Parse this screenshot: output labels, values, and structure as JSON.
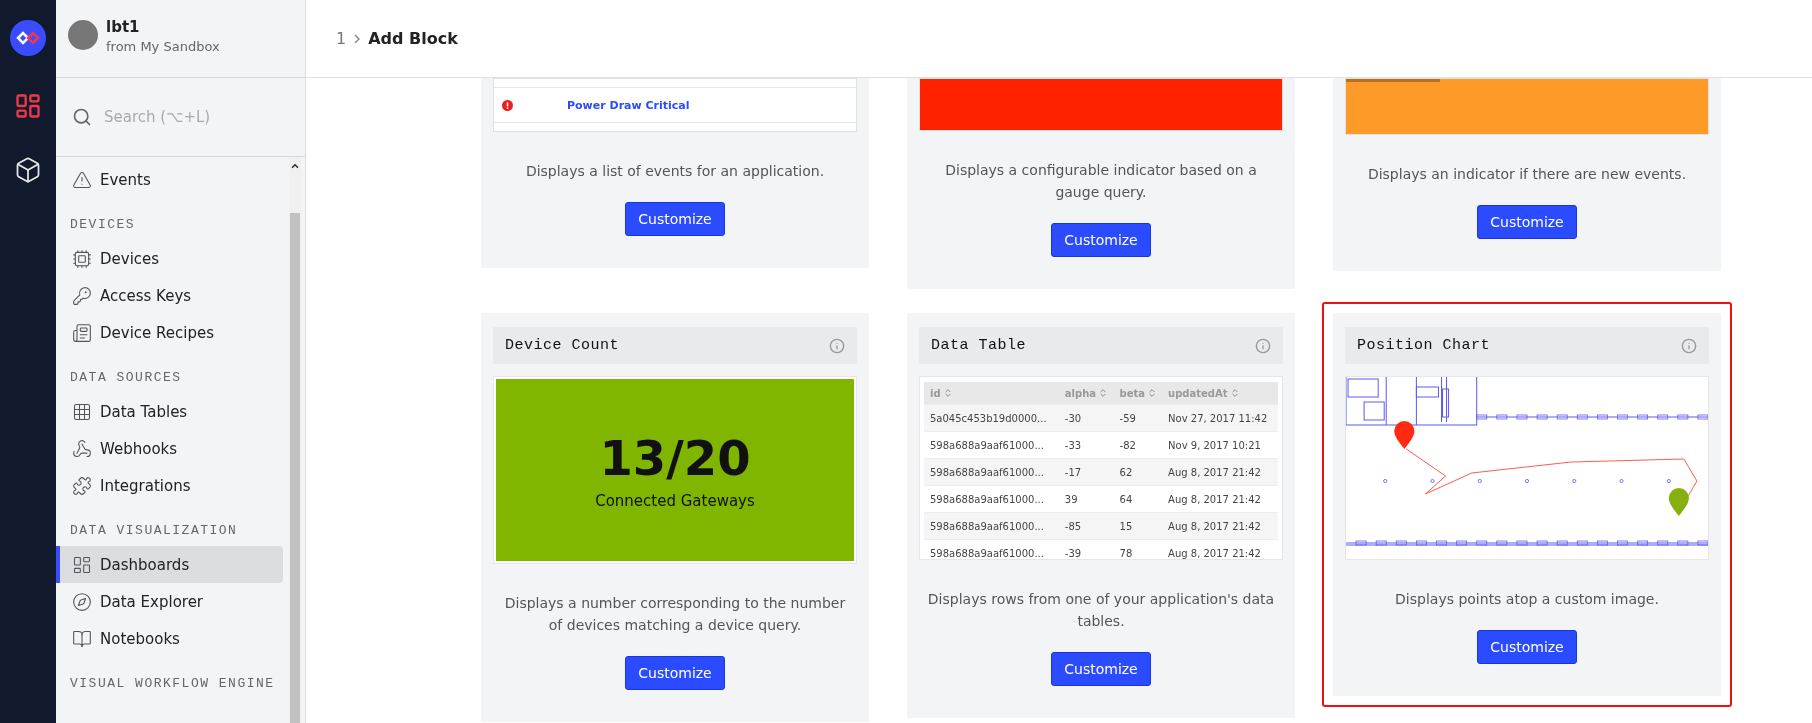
{
  "rail": {
    "items": [
      {
        "kind": "logo",
        "selected": false
      },
      {
        "kind": "dashboards",
        "selected": true
      },
      {
        "kind": "packages",
        "selected": false
      }
    ]
  },
  "sidebar": {
    "app_name": "lbt1",
    "app_subtitle": "from My Sandbox",
    "search": {
      "placeholder": "Search (⌥+L)"
    },
    "sections": [
      {
        "items": [
          {
            "kind": "events",
            "label": "Events",
            "selected": false
          }
        ]
      },
      {
        "heading": "DEVICES",
        "items": [
          {
            "kind": "devices",
            "label": "Devices",
            "selected": false
          },
          {
            "kind": "keys",
            "label": "Access Keys",
            "selected": false
          },
          {
            "kind": "recipes",
            "label": "Device Recipes",
            "selected": false
          }
        ]
      },
      {
        "heading": "DATA SOURCES",
        "items": [
          {
            "kind": "tables",
            "label": "Data Tables",
            "selected": false
          },
          {
            "kind": "webhooks",
            "label": "Webhooks",
            "selected": false
          },
          {
            "kind": "integrations",
            "label": "Integrations",
            "selected": false
          }
        ]
      },
      {
        "heading": "DATA VISUALIZATION",
        "items": [
          {
            "kind": "dashboards",
            "label": "Dashboards",
            "selected": true
          },
          {
            "kind": "explorer",
            "label": "Data Explorer",
            "selected": false
          },
          {
            "kind": "notebooks",
            "label": "Notebooks",
            "selected": false
          }
        ]
      },
      {
        "heading": "VISUAL WORKFLOW ENGINE"
      }
    ]
  },
  "breadcrumb": [
    {
      "label": "1",
      "current": false
    },
    {
      "label": "Add Block",
      "current": true
    }
  ],
  "cards": [
    {
      "kind": "event_list",
      "events": [
        {
          "label": "Power Draw Critical",
          "kind": "critical"
        }
      ],
      "description": "Displays a list of events for an application.",
      "button": "Customize",
      "highlighted": false
    },
    {
      "kind": "gauge",
      "description": "Displays a configurable indicator based on a gauge query.",
      "button": "Customize",
      "highlighted": false
    },
    {
      "kind": "new_events",
      "description": "Displays an indicator if there are new events.",
      "button": "Customize",
      "highlighted": false
    },
    {
      "kind": "device_count",
      "title": "Device Count",
      "value": "13/20",
      "caption": "Connected Gateways",
      "description": "Displays a number corresponding to the number of devices matching a device query.",
      "button": "Customize",
      "highlighted": false
    },
    {
      "kind": "data_table",
      "title": "Data Table",
      "columns": [
        "id",
        "alpha",
        "beta",
        "updatedAt"
      ],
      "rows": [
        [
          "5a045c453b19d0000...",
          "-30",
          "-59",
          "Nov 27, 2017 11:42"
        ],
        [
          "598a688a9aaf61000...",
          "-33",
          "-82",
          "Nov 9, 2017 10:21"
        ],
        [
          "598a688a9aaf61000...",
          "-17",
          "62",
          "Aug 8, 2017 21:42"
        ],
        [
          "598a688a9aaf61000...",
          "39",
          "64",
          "Aug 8, 2017 21:42"
        ],
        [
          "598a688a9aaf61000...",
          "-85",
          "15",
          "Aug 8, 2017 21:42"
        ],
        [
          "598a688a9aaf61000...",
          "-39",
          "78",
          "Aug 8, 2017 21:42"
        ]
      ],
      "description": "Displays rows from one of your application's data tables.",
      "button": "Customize",
      "highlighted": false
    },
    {
      "kind": "position_chart",
      "title": "Position Chart",
      "description": "Displays points atop a custom image.",
      "button": "Customize",
      "highlighted": true
    }
  ]
}
